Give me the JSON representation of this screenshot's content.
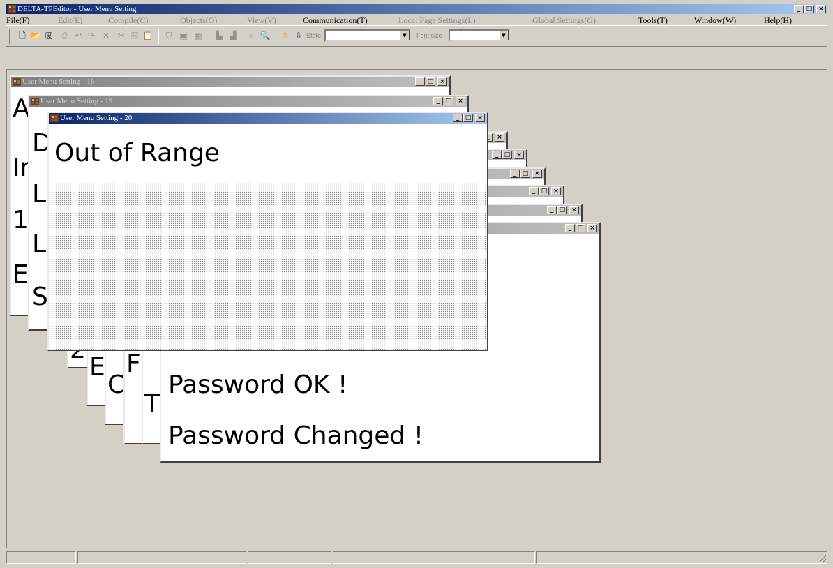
{
  "app": {
    "title": "DELTA-TPEditor - User Menu Setting",
    "controls": {
      "minimize": "_",
      "maximize": "□",
      "close": "×"
    }
  },
  "menu": {
    "items": [
      {
        "label": "File(F)",
        "enabled": true
      },
      {
        "label": "Edit(E)",
        "enabled": false
      },
      {
        "label": "Compile(C)",
        "enabled": false
      },
      {
        "label": "Objects(O)",
        "enabled": false
      },
      {
        "label": "View(V)",
        "enabled": false
      },
      {
        "label": "Communication(T)",
        "enabled": true
      },
      {
        "label": "Local Page Settings(L)",
        "enabled": false
      },
      {
        "label": "Global Settings(G)",
        "enabled": false
      },
      {
        "label": "Tools(T)",
        "enabled": true
      },
      {
        "label": "Window(W)",
        "enabled": true
      },
      {
        "label": "Help(H)",
        "enabled": true
      }
    ]
  },
  "toolbar": {
    "icons": [
      "new-icon",
      "open-icon",
      "save-icon",
      "print-icon",
      "undo-icon",
      "redo-icon",
      "delete-icon",
      "cut-icon",
      "copy-icon",
      "paste-icon",
      "compile-icon",
      "upload-icon",
      "download-icon",
      "page-prev-icon",
      "page-next-icon",
      "zoom-out-icon",
      "zoom-in-icon",
      "arrow-up-icon",
      "arrow-down-icon"
    ],
    "state_label": "State",
    "state_value": "",
    "font_size_label": "Font size",
    "font_size_value": ""
  },
  "windows": {
    "w18": {
      "title": "User Menu Setting - 18",
      "items": [
        "A",
        "In",
        "1",
        "E"
      ]
    },
    "w19": {
      "title": "User Menu Setting - 19",
      "items": [
        "D",
        "L",
        "L",
        "S"
      ]
    },
    "w20": {
      "title": "User Menu Setting - 20",
      "message": "Out of Range"
    },
    "back": {
      "items": [
        "2",
        "E",
        "C",
        "F",
        "T"
      ]
    },
    "front": {
      "line1": "Password OK !",
      "line2": "Password Changed !"
    }
  },
  "colors": {
    "active_title_start": "#0a246a",
    "active_title_end": "#a6caf0",
    "inactive_title_start": "#808080",
    "inactive_title_end": "#c0c0c0",
    "face": "#d4d0c8"
  },
  "statusbar": {
    "panels": [
      "",
      "",
      "",
      "",
      "",
      ""
    ]
  }
}
